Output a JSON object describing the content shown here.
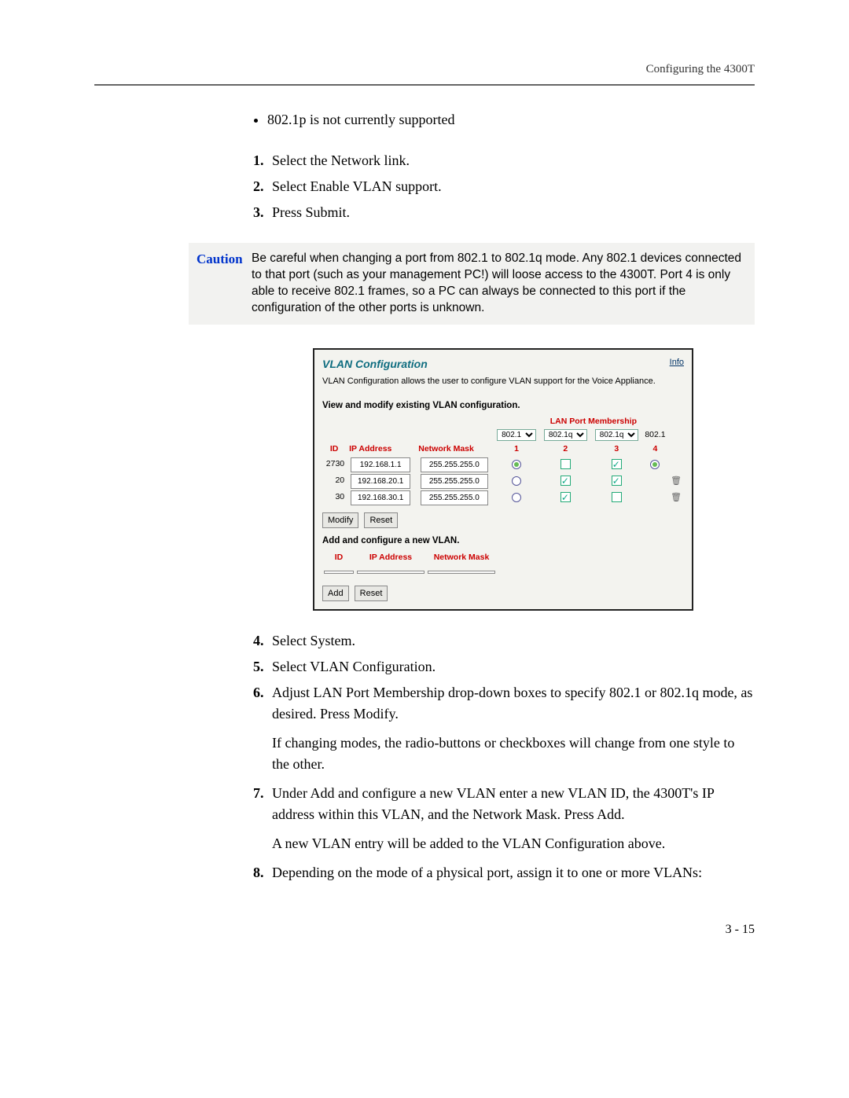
{
  "header": {
    "title": "Configuring the 4300T"
  },
  "bullet": "802.1p is not currently supported",
  "steps123": [
    "Select the Network link.",
    "Select Enable VLAN support.",
    "Press Submit."
  ],
  "caution": {
    "label": "Caution",
    "text": "Be careful when changing a port from 802.1 to 802.1q mode.  Any 802.1 devices connected to that port (such as your management PC!) will loose access to the 4300T.  Port 4 is only able to receive 802.1 frames, so a PC can always be connected to this port if the configuration of the other ports is unknown."
  },
  "screenshot": {
    "title": "VLAN Configuration",
    "info": "Info",
    "desc": "VLAN Configuration allows the user to configure VLAN support for the Voice Appliance.",
    "view_title": "View and modify existing VLAN configuration.",
    "port_membership": "LAN Port Membership",
    "dropdowns": [
      "802.1",
      "802.1q",
      "802.1q"
    ],
    "port4_label": "802.1",
    "cols": {
      "id": "ID",
      "ip": "IP Address",
      "mask": "Network Mask",
      "p1": "1",
      "p2": "2",
      "p3": "3",
      "p4": "4"
    },
    "rows": [
      {
        "id": "2730",
        "ip": "192.168.1.1",
        "mask": "255.255.255.0",
        "p1": "radio-on",
        "p2": "unchecked",
        "p3": "checked",
        "p4": "radio-on",
        "trash": false
      },
      {
        "id": "20",
        "ip": "192.168.20.1",
        "mask": "255.255.255.0",
        "p1": "radio-off",
        "p2": "checked",
        "p3": "checked",
        "p4": "",
        "trash": true
      },
      {
        "id": "30",
        "ip": "192.168.30.1",
        "mask": "255.255.255.0",
        "p1": "radio-off",
        "p2": "checked",
        "p3": "unchecked",
        "p4": "",
        "trash": true
      }
    ],
    "modify_btn": "Modify",
    "reset_btn": "Reset",
    "add_title": "Add and configure a new VLAN.",
    "add_cols": {
      "id": "ID",
      "ip": "IP Address",
      "mask": "Network Mask"
    },
    "add_btn": "Add",
    "reset2_btn": "Reset"
  },
  "steps48": [
    {
      "n": "4",
      "t": "Select System."
    },
    {
      "n": "5",
      "t": "Select VLAN Configuration."
    },
    {
      "n": "6",
      "t": "Adjust LAN Port Membership drop-down boxes to specify 802.1 or 802.1q mode, as desired.  Press Modify.",
      "after": "If changing modes, the radio-buttons or checkboxes will change from one style to the other."
    },
    {
      "n": "7",
      "t": "Under Add and configure a new VLAN enter a new VLAN ID, the 4300T's IP address within this VLAN, and the Network Mask.  Press Add.",
      "after": "A new VLAN entry will be added to the VLAN Configuration above."
    },
    {
      "n": "8",
      "t": "Depending on the mode of a physical port, assign it to one or more VLANs:"
    }
  ],
  "footer": "3 - 15"
}
